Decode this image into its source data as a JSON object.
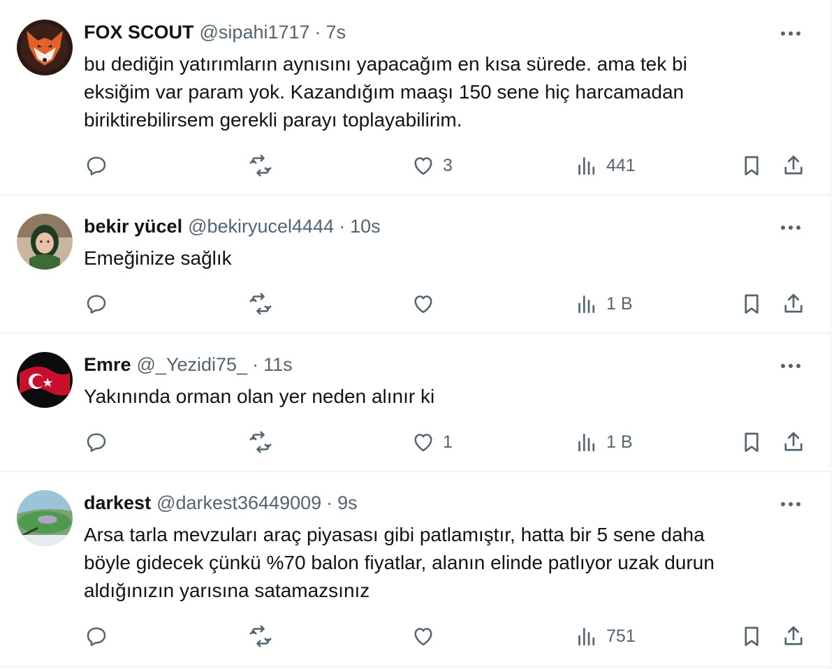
{
  "replies": [
    {
      "name": "FOX SCOUT",
      "handle": "@sipahi1717",
      "separator": "·",
      "time": "7s",
      "text": "bu dediğin yatırımların aynısını yapacağım en kısa sürede. ama tek bi\neksiğim var param yok. Kazandığım maaşı  150 sene hiç harcamadan\nbiriktirebilirsem gerekli parayı toplayabilirim.",
      "avatar_icon": "fox-logo-avatar",
      "like_count": "3",
      "view_count": "441"
    },
    {
      "name": "bekir yücel",
      "handle": "@bekiryucel4444",
      "separator": "·",
      "time": "10s",
      "text": "Emeğinize sağlık",
      "avatar_icon": "child-photo-avatar",
      "like_count": "",
      "view_count": "1 B"
    },
    {
      "name": "Emre",
      "handle": "@_Yezidi75_",
      "separator": "·",
      "time": "11s",
      "text": "Yakınında orman olan yer neden alınır ki",
      "avatar_icon": "turkish-flag-avatar",
      "like_count": "1",
      "view_count": "1 B"
    },
    {
      "name": "darkest",
      "handle": "@darkest36449009",
      "separator": "·",
      "time": "9s",
      "text": "Arsa tarla mevzuları araç piyasası gibi patlamıştır, hatta bir 5 sene daha\nböyle gidecek çünkü %70 balon fiyatlar, alanın elinde patlıyor uzak durun\naldığınızın yarısına satamazsınız",
      "avatar_icon": "green-abstract-avatar",
      "like_count": "",
      "view_count": "751"
    }
  ],
  "colors": {
    "text_primary": "#0f1419",
    "text_secondary": "#536471",
    "divider": "#eff3f4",
    "background": "#ffffff"
  }
}
